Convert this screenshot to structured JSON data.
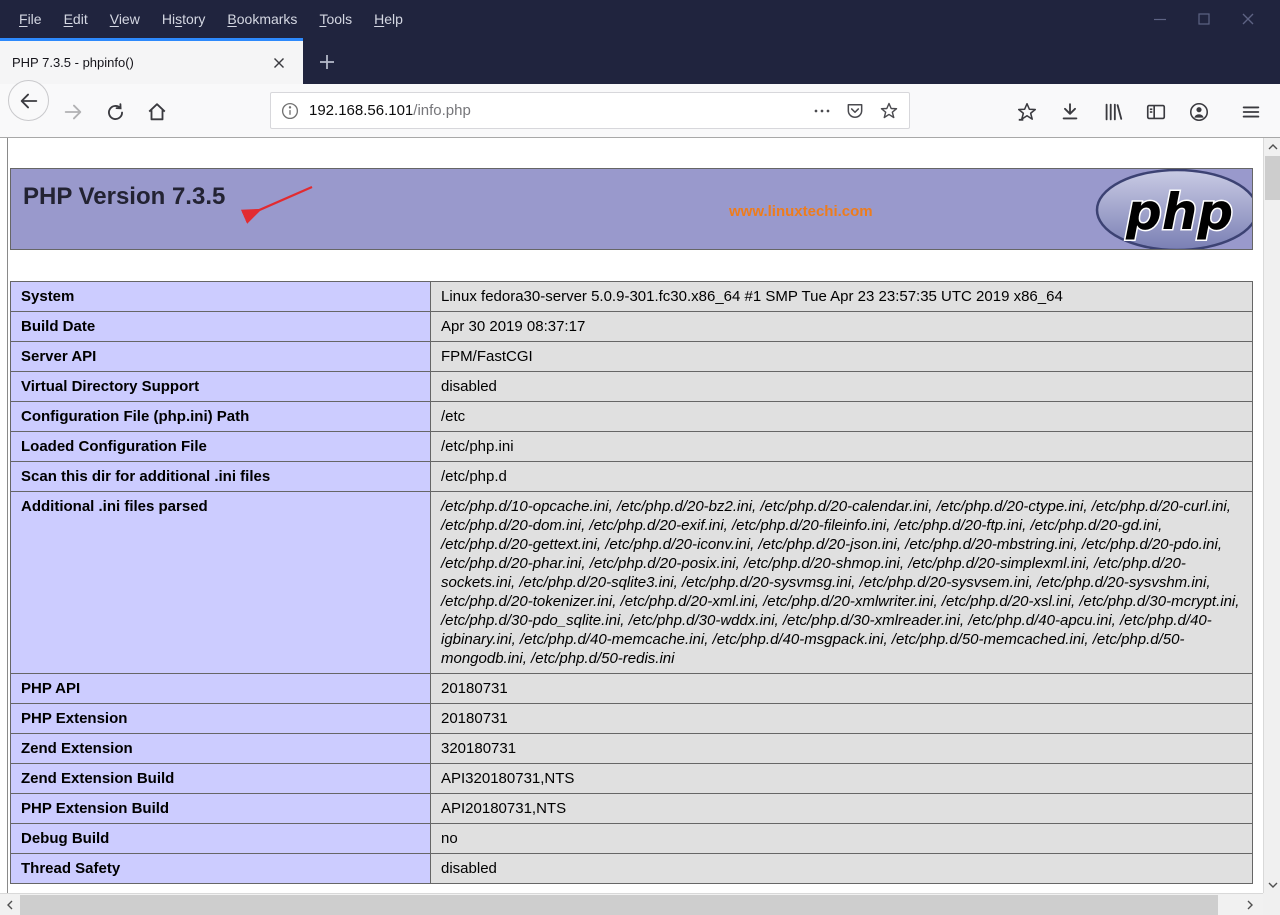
{
  "window": {
    "menu_items": [
      {
        "pre": "",
        "key": "F",
        "post": "ile"
      },
      {
        "pre": "",
        "key": "E",
        "post": "dit"
      },
      {
        "pre": "",
        "key": "V",
        "post": "iew"
      },
      {
        "pre": "Hi",
        "key": "s",
        "post": "tory"
      },
      {
        "pre": "",
        "key": "B",
        "post": "ookmarks"
      },
      {
        "pre": "",
        "key": "T",
        "post": "ools"
      },
      {
        "pre": "",
        "key": "H",
        "post": "elp"
      }
    ]
  },
  "tab": {
    "title": "PHP 7.3.5 - phpinfo()"
  },
  "toolbar": {
    "url_host": "192.168.56.101",
    "url_path": "/info.php"
  },
  "page": {
    "title": "PHP Version 7.3.5",
    "watermark": "www.linuxtechi.com",
    "logo_text": "php",
    "colors": {
      "header_bg": "#9999cc",
      "label_cell_bg": "#ccccff",
      "value_cell_bg": "#e0e0e0",
      "watermark_orange": "#ee7c1c",
      "annotation_red": "#e22b30",
      "titlebar_navy": "#20243e",
      "tab_accent_blue": "#2d89fc"
    },
    "info_rows": [
      {
        "label": "System",
        "value": "Linux fedora30-server 5.0.9-301.fc30.x86_64 #1 SMP Tue Apr 23 23:57:35 UTC 2019 x86_64"
      },
      {
        "label": "Build Date",
        "value": "Apr 30 2019 08:37:17"
      },
      {
        "label": "Server API",
        "value": "FPM/FastCGI"
      },
      {
        "label": "Virtual Directory Support",
        "value": "disabled"
      },
      {
        "label": "Configuration File (php.ini) Path",
        "value": "/etc"
      },
      {
        "label": "Loaded Configuration File",
        "value": "/etc/php.ini"
      },
      {
        "label": "Scan this dir for additional .ini files",
        "value": "/etc/php.d"
      },
      {
        "label": "Additional .ini files parsed",
        "value": "/etc/php.d/10-opcache.ini, /etc/php.d/20-bz2.ini, /etc/php.d/20-calendar.ini, /etc/php.d/20-ctype.ini, /etc/php.d/20-curl.ini, /etc/php.d/20-dom.ini, /etc/php.d/20-exif.ini, /etc/php.d/20-fileinfo.ini, /etc/php.d/20-ftp.ini, /etc/php.d/20-gd.ini, /etc/php.d/20-gettext.ini, /etc/php.d/20-iconv.ini, /etc/php.d/20-json.ini, /etc/php.d/20-mbstring.ini, /etc/php.d/20-pdo.ini, /etc/php.d/20-phar.ini, /etc/php.d/20-posix.ini, /etc/php.d/20-shmop.ini, /etc/php.d/20-simplexml.ini, /etc/php.d/20-sockets.ini, /etc/php.d/20-sqlite3.ini, /etc/php.d/20-sysvmsg.ini, /etc/php.d/20-sysvsem.ini, /etc/php.d/20-sysvshm.ini, /etc/php.d/20-tokenizer.ini, /etc/php.d/20-xml.ini, /etc/php.d/20-xmlwriter.ini, /etc/php.d/20-xsl.ini, /etc/php.d/30-mcrypt.ini, /etc/php.d/30-pdo_sqlite.ini, /etc/php.d/30-wddx.ini, /etc/php.d/30-xmlreader.ini, /etc/php.d/40-apcu.ini, /etc/php.d/40-igbinary.ini, /etc/php.d/40-memcache.ini, /etc/php.d/40-msgpack.ini, /etc/php.d/50-memcached.ini, /etc/php.d/50-mongodb.ini, /etc/php.d/50-redis.ini",
        "italic": true
      },
      {
        "label": "PHP API",
        "value": "20180731"
      },
      {
        "label": "PHP Extension",
        "value": "20180731"
      },
      {
        "label": "Zend Extension",
        "value": "320180731"
      },
      {
        "label": "Zend Extension Build",
        "value": "API320180731,NTS"
      },
      {
        "label": "PHP Extension Build",
        "value": "API20180731,NTS"
      },
      {
        "label": "Debug Build",
        "value": "no"
      },
      {
        "label": "Thread Safety",
        "value": "disabled"
      }
    ]
  }
}
